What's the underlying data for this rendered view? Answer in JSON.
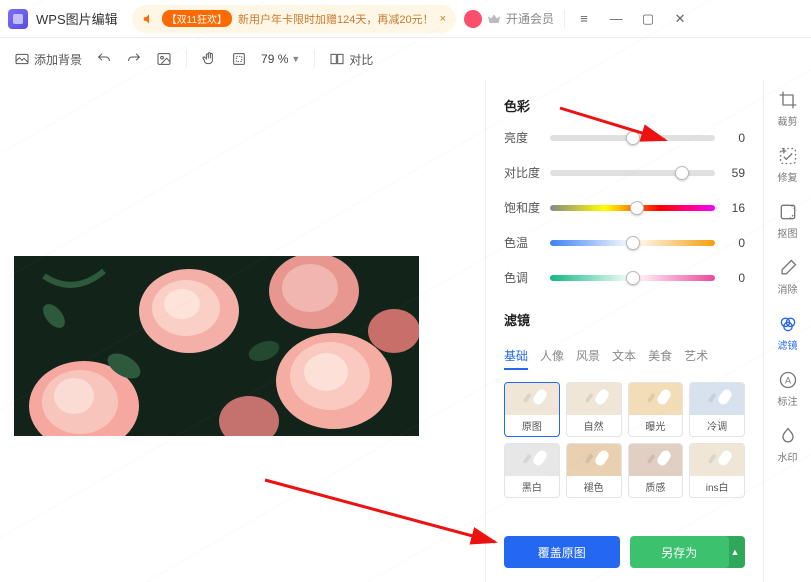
{
  "app": {
    "title": "WPS图片编辑"
  },
  "promo": {
    "badge": "【双11狂欢】",
    "text": "新用户年卡限时加赠124天，再减20元！",
    "close": "×"
  },
  "membership": {
    "text": "开通会员"
  },
  "toolbar": {
    "add_bg": "添加背景",
    "zoom": "79 %",
    "compare": "对比"
  },
  "panel": {
    "color_title": "色彩",
    "sliders": {
      "brightness": {
        "label": "亮度",
        "value": 0,
        "pos": 50
      },
      "contrast": {
        "label": "对比度",
        "value": 59,
        "pos": 80
      },
      "saturation": {
        "label": "饱和度",
        "value": 16,
        "pos": 53
      },
      "temperature": {
        "label": "色温",
        "value": 0,
        "pos": 50
      },
      "tint": {
        "label": "色调",
        "value": 0,
        "pos": 50
      }
    },
    "filter_title": "滤镜",
    "filter_tabs": [
      "基础",
      "人像",
      "风景",
      "文本",
      "美食",
      "艺术"
    ],
    "filter_tab_active": 0,
    "filters": [
      {
        "name": "原图",
        "style": "",
        "selected": true
      },
      {
        "name": "自然",
        "style": ""
      },
      {
        "name": "曝光",
        "style": "warm"
      },
      {
        "name": "冷调",
        "style": "cold"
      },
      {
        "name": "黑白",
        "style": "bw"
      },
      {
        "name": "褪色",
        "style": "tan"
      },
      {
        "name": "质感",
        "style": "mood"
      },
      {
        "name": "ins白",
        "style": ""
      }
    ],
    "btn_overwrite": "覆盖原图",
    "btn_saveas": "另存为"
  },
  "tools": [
    {
      "name": "裁剪",
      "icon": "crop"
    },
    {
      "name": "修复",
      "icon": "heal"
    },
    {
      "name": "抠图",
      "icon": "cutout"
    },
    {
      "name": "消除",
      "icon": "erase"
    },
    {
      "name": "滤镜",
      "icon": "filter",
      "active": true
    },
    {
      "name": "标注",
      "icon": "annotate"
    },
    {
      "name": "水印",
      "icon": "watermark"
    }
  ]
}
